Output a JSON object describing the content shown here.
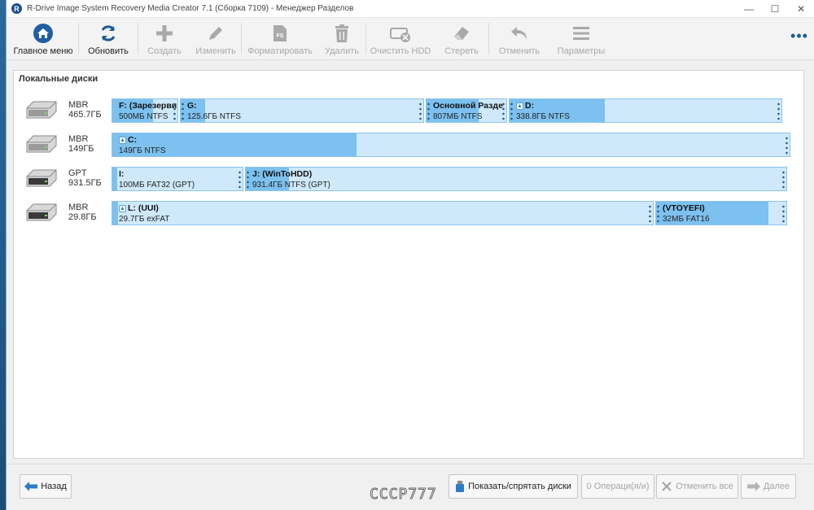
{
  "window": {
    "title": "R-Drive Image System Recovery Media Creator 7.1 (Сборка 7109) - Менеджер Разделов",
    "logo_letter": "R"
  },
  "toolbar": {
    "main_menu": "Главное меню",
    "refresh": "Обновить",
    "create": "Создать",
    "edit": "Изменить",
    "format": "Форматировать",
    "delete": "Удалить",
    "wipe_hdd": "Очистить HDD",
    "erase": "Стереть",
    "undo": "Отменить",
    "settings": "Параметры",
    "more": "•••",
    "format_icon_text": "FS"
  },
  "panel": {
    "title": "Локальные диски"
  },
  "disks": [
    {
      "scheme": "MBR",
      "size": "465.7ГБ",
      "partitions": [
        {
          "name": "F: (Зарезерви",
          "info": "500МБ NTFS",
          "used": 0.62,
          "sys": false
        },
        {
          "name": "G:",
          "info": "125.6ГБ NTFS",
          "used": 0.1,
          "sys": false
        },
        {
          "name": "Основной Разде",
          "info": "807МБ NTFS",
          "used": 0.65,
          "sys": false
        },
        {
          "name": "D:",
          "info": "338.8ГБ NTFS",
          "used": 0.35,
          "sys": true
        }
      ]
    },
    {
      "scheme": "MBR",
      "size": "149ГБ",
      "partitions": [
        {
          "name": "C:",
          "info": "149ГБ NTFS",
          "used": 0.36,
          "sys": true
        }
      ]
    },
    {
      "scheme": "GPT",
      "size": "931.5ГБ",
      "partitions": [
        {
          "name": "I:",
          "info": "100МБ FAT32 (GPT)",
          "used": 0.04,
          "sys": false
        },
        {
          "name": "J: (WinToHDD)",
          "info": "931.4ГБ NTFS (GPT)",
          "used": 0.08,
          "sys": false
        }
      ]
    },
    {
      "scheme": "MBR",
      "size": "29.8ГБ",
      "partitions": [
        {
          "name": "L: (UUI)",
          "info": "29.7ГБ exFAT",
          "used": 0.01,
          "sys": true
        },
        {
          "name": "(VTOYEFI)",
          "info": "32МБ FAT16",
          "used": 0.86,
          "sys": false
        }
      ]
    }
  ],
  "bottom": {
    "back": "Назад",
    "show_hide": "Показать/спрятать диски",
    "operations": "0 Операци(я/и)",
    "cancel_all": "Отменить все",
    "next": "Далее",
    "watermark": "СССР777"
  },
  "colors": {
    "accent": "#1c5a9a",
    "partition_fill": "#7cc1ef",
    "partition_bg": "#cfe9fb"
  }
}
